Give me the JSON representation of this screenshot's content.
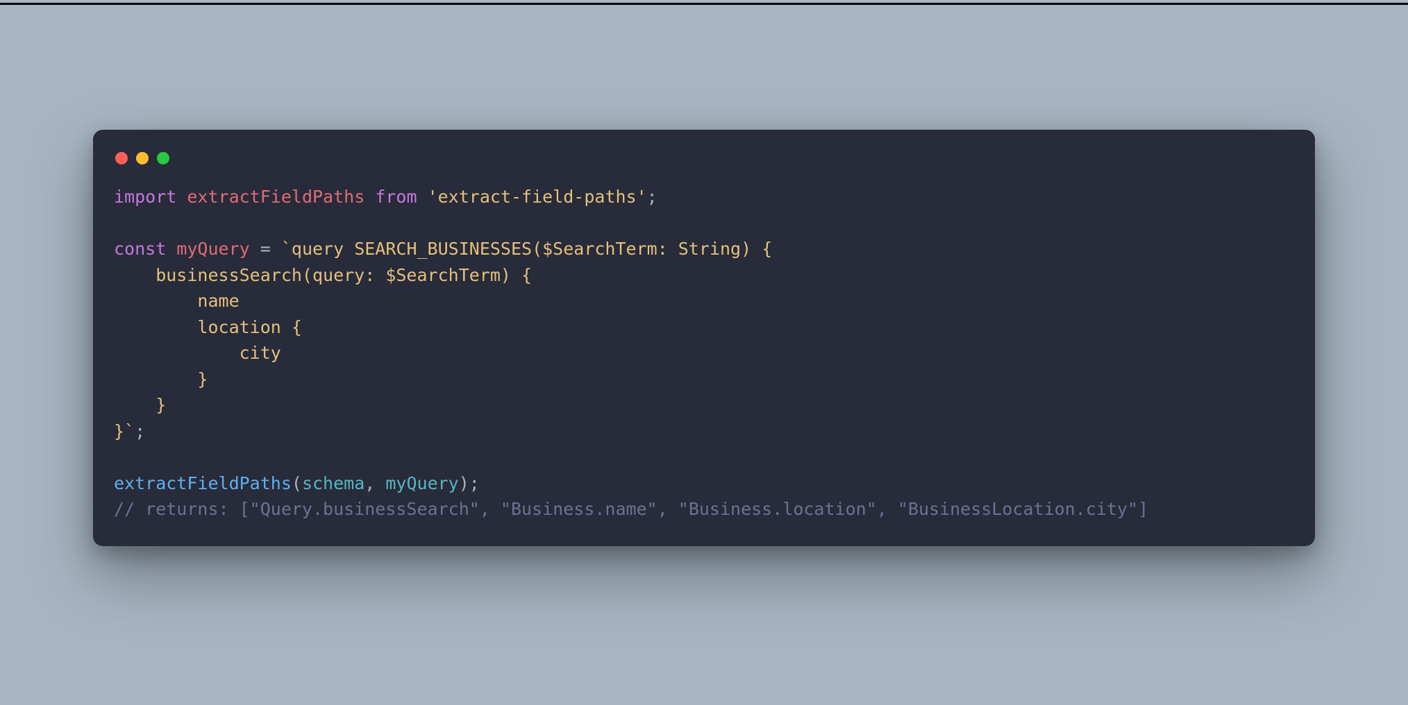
{
  "colors": {
    "page_bg": "#a7b5c2",
    "window_bg": "#272b3a",
    "traffic_red": "#ff5f56",
    "traffic_yellow": "#ffbd2e",
    "traffic_green": "#27c93f",
    "tok_keyword": "#c678dd",
    "tok_ident": "#e06c75",
    "tok_string": "#e5c07b",
    "tok_punct": "#abb2bf",
    "tok_call": "#61afef",
    "tok_var": "#56b6c2",
    "tok_comment": "#6b7394"
  },
  "code": {
    "line1": {
      "kw_import": "import",
      "ident": "extractFieldPaths",
      "kw_from": "from",
      "string": "'extract-field-paths'",
      "semi": ";"
    },
    "line3": {
      "kw_const": "const",
      "ident": "myQuery",
      "eq": " = ",
      "tmpl": "`query SEARCH_BUSINESSES($SearchTerm: String) {"
    },
    "line4": "    businessSearch(query: $SearchTerm) {",
    "line5": "        name",
    "line6": "        location {",
    "line7": "            city",
    "line8": "        }",
    "line9": "    }",
    "line10": {
      "tmpl_end": "}`",
      "semi": ";"
    },
    "line12": {
      "call": "extractFieldPaths",
      "open": "(",
      "arg1": "schema",
      "comma": ", ",
      "arg2": "myQuery",
      "close": ")",
      "semi": ";"
    },
    "line13": "// returns: [\"Query.businessSearch\", \"Business.name\", \"Business.location\", \"BusinessLocation.city\"]"
  }
}
